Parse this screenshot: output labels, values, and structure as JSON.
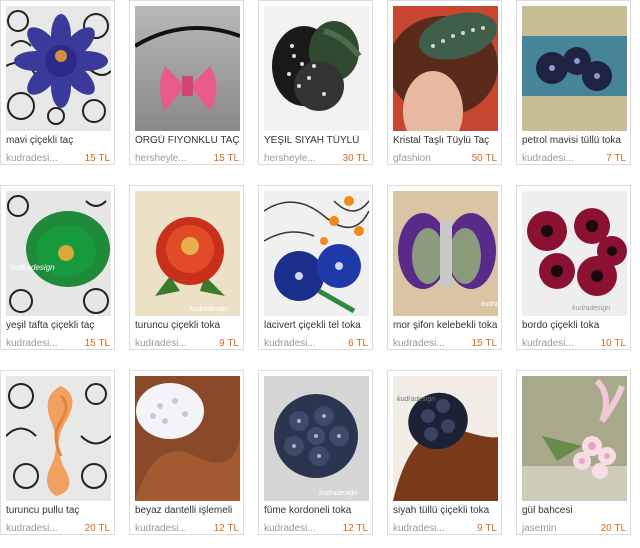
{
  "items": [
    {
      "title": "mavi çiçekli taç",
      "seller": "kudradesi...",
      "price": "15 TL",
      "image": "blue-flower-crown-photo"
    },
    {
      "title": "ÖRGÜ FİYONKLU TAÇ",
      "seller": "hersheyle...",
      "price": "15 TL",
      "image": "pink-knit-bow-headband-photo"
    },
    {
      "title": "YEŞİL SİYAH TÜYLÜ",
      "seller": "hersheyle...",
      "price": "30 TL",
      "image": "green-black-feather-photo"
    },
    {
      "title": "Kristal Taşlı Tüylü Taç",
      "seller": "gfashion",
      "price": "50 TL",
      "image": "crystal-feather-headpiece-photo"
    },
    {
      "title": "petrol mavisi tüllü toka",
      "seller": "kudradesi...",
      "price": "7 TL",
      "image": "teal-tulle-clip-photo"
    },
    {
      "title": "yeşil tafta çiçekli taç",
      "seller": "kudradesi...",
      "price": "15 TL",
      "image": "green-taffeta-flower-photo",
      "watermark": "kudradesign"
    },
    {
      "title": "turuncu çiçekli toka",
      "seller": "kudradesi...",
      "price": "9 TL",
      "image": "orange-flower-clip-photo",
      "watermark": "kudradesign"
    },
    {
      "title": "lacivert çiçekli tel toka",
      "seller": "kudradesi...",
      "price": "6 TL",
      "image": "navy-flower-wire-clip-photo"
    },
    {
      "title": "mor şifon kelebekli toka",
      "seller": "kudradesi...",
      "price": "15 TL",
      "image": "purple-chiffon-butterfly-photo",
      "watermark": "kudradesign"
    },
    {
      "title": "bordo çiçekli toka",
      "seller": "kudradesi...",
      "price": "10 TL",
      "image": "burgundy-flowers-photo",
      "watermark": "kudradesign"
    },
    {
      "title": "turuncu pullu taç",
      "seller": "kudradesi...",
      "price": "20 TL",
      "image": "orange-sequin-crown-photo"
    },
    {
      "title": "beyaz dantelli işlemeli",
      "seller": "kudradesi...",
      "price": "12 TL",
      "image": "white-lace-clip-photo"
    },
    {
      "title": "füme kordoneli toka",
      "seller": "kudradesi...",
      "price": "12 TL",
      "image": "smoke-cord-clip-photo",
      "watermark": "kudradesign"
    },
    {
      "title": "siyah tüllü çiçekli toka",
      "seller": "kudradesi...",
      "price": "9 TL",
      "image": "black-tulle-flower-photo",
      "watermark": "kudradesign"
    },
    {
      "title": "gül bahcesi",
      "seller": "jasemin",
      "price": "20 TL",
      "image": "rose-garden-fascinator-photo"
    }
  ],
  "colors": {
    "price": "#d2691e",
    "seller": "#999999",
    "title": "#333333",
    "border": "#dcdcdc"
  }
}
